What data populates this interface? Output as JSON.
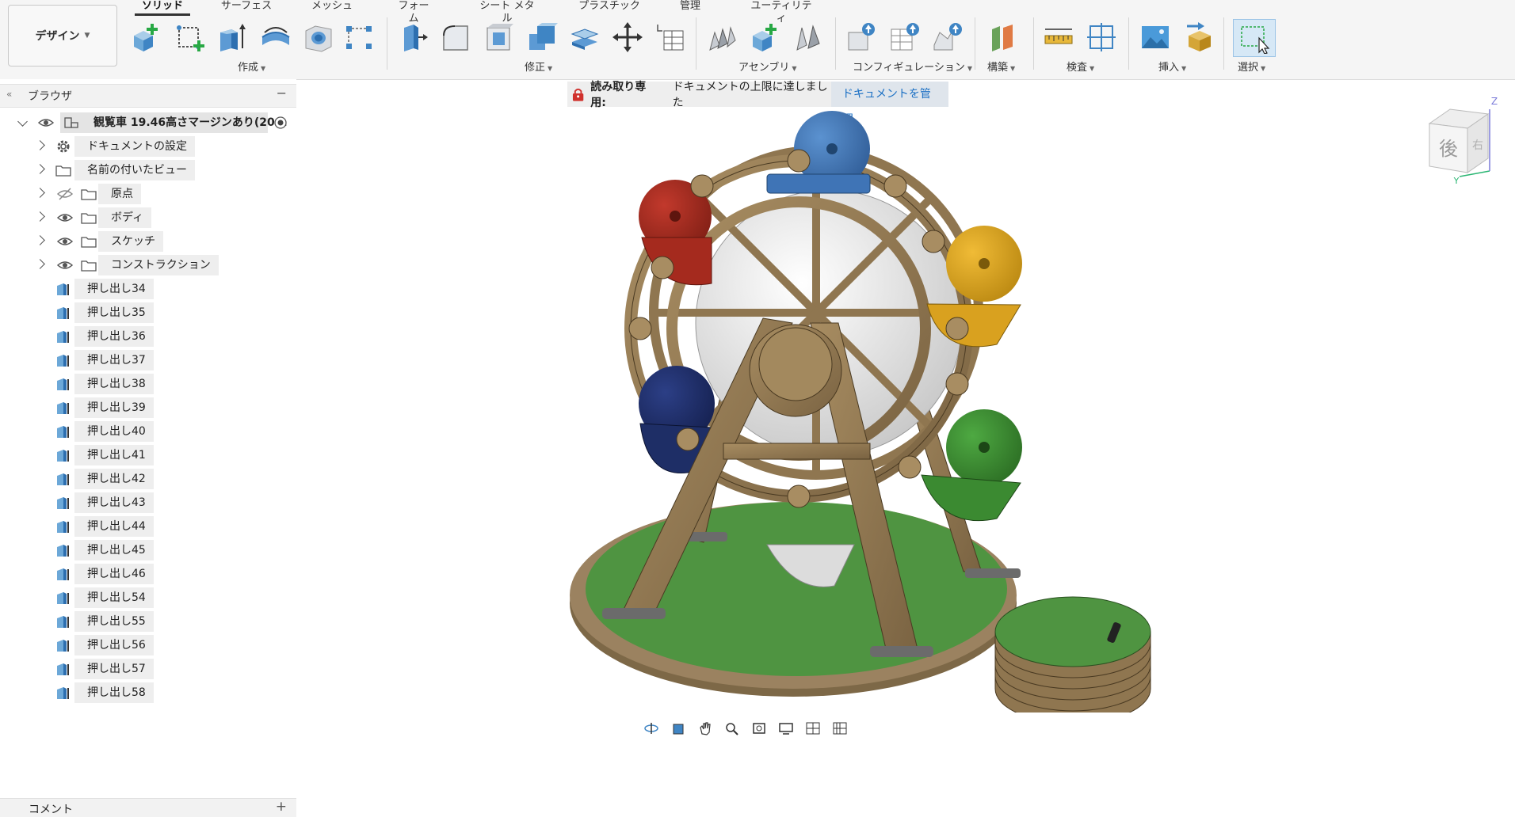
{
  "toolbar": {
    "design_label": "デザイン",
    "tabs": [
      {
        "label": "ソリッド",
        "active": true
      },
      {
        "label": "サーフェス"
      },
      {
        "label": "メッシュ"
      },
      {
        "label": "フォーム"
      },
      {
        "label": "シート メタル"
      },
      {
        "label": "プラスチック"
      },
      {
        "label": "管理"
      },
      {
        "label": "ユーティリティ"
      }
    ],
    "groups": [
      {
        "label": "作成"
      },
      {
        "label": "修正"
      },
      {
        "label": "アセンブリ"
      },
      {
        "label": "コンフィギュレーション"
      },
      {
        "label": "構築"
      },
      {
        "label": "検査"
      },
      {
        "label": "挿入"
      },
      {
        "label": "選択"
      }
    ],
    "tools": {
      "create": [
        "new-component-icon",
        "create-sketch-icon",
        "extrude-icon",
        "revolve-icon",
        "hole-icon",
        "pattern-icon"
      ],
      "modify": [
        "press-pull-icon",
        "fillet-icon",
        "shell-icon",
        "combine-icon",
        "offset-face-icon",
        "move-icon",
        "parameters-icon"
      ],
      "assemble": [
        "joint-icon",
        "new-component-assemble-icon",
        "as-built-joint-icon"
      ],
      "configure": [
        "configure-icon",
        "configuration-table-icon",
        "configure-model-icon"
      ],
      "construct": [
        "offset-plane-icon"
      ],
      "inspect": [
        "measure-icon",
        "section-analysis-icon"
      ],
      "insert": [
        "insert-image-icon",
        "insert-mesh-icon"
      ],
      "select": [
        "select-icon"
      ]
    }
  },
  "browser": {
    "title": "ブラウザ",
    "root_label": "観覧車 19.46高さマージンあり(20...",
    "folders": [
      {
        "label": "ドキュメントの設定",
        "icon": "gear-icon"
      },
      {
        "label": "名前の付いたビュー",
        "icon": "folder-icon"
      },
      {
        "label": "原点",
        "icon": "folder-icon",
        "eye": "hidden"
      },
      {
        "label": "ボディ",
        "icon": "folder-icon",
        "eye": "visible"
      },
      {
        "label": "スケッチ",
        "icon": "folder-icon",
        "eye": "visible"
      },
      {
        "label": "コンストラクション",
        "icon": "folder-icon",
        "eye": "visible"
      }
    ],
    "features": [
      "押し出し34",
      "押し出し35",
      "押し出し36",
      "押し出し37",
      "押し出し38",
      "押し出し39",
      "押し出し40",
      "押し出し41",
      "押し出し42",
      "押し出し43",
      "押し出し44",
      "押し出し45",
      "押し出し46",
      "押し出し54",
      "押し出し55",
      "押し出し56",
      "押し出し57",
      "押し出し58"
    ],
    "comment_label": "コメント"
  },
  "notice": {
    "label": "読み取り専用:",
    "message": "ドキュメントの上限に達しました",
    "link": "ドキュメントを管理"
  },
  "viewcube": {
    "face_label": "後",
    "side_label": "右",
    "z_axis": "Z",
    "y_axis": "Y"
  },
  "navbar": {
    "icons": [
      "orbit-icon",
      "look-at-icon",
      "pan-icon",
      "zoom-icon",
      "fit-icon",
      "display-settings-icon",
      "grid-icon",
      "viewports-icon"
    ]
  },
  "colors": {
    "accent": "#1a6fc4",
    "wood": "#8f7650",
    "base_green": "#4f9441",
    "cabin_red": "#a52a1e",
    "cabin_blue": "#3f74b6",
    "cabin_yellow": "#d9a11f",
    "cabin_green": "#3b8a31",
    "cabin_navy": "#1e2e66",
    "cabin_white": "#dcdcdc"
  }
}
